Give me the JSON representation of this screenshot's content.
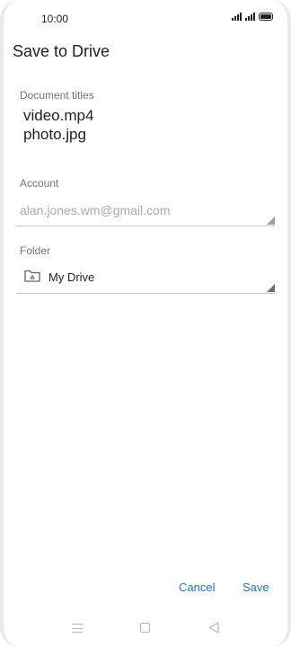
{
  "status_bar": {
    "time": "10:00"
  },
  "header": {
    "title": "Save to Drive"
  },
  "document": {
    "label": "Document titles",
    "titles": [
      "video.mp4",
      "photo.jpg"
    ]
  },
  "account": {
    "label": "Account",
    "value": "alan.jones.wm@gmail.com"
  },
  "folder": {
    "label": "Folder",
    "value": "My Drive",
    "icon": "drive-folder-icon"
  },
  "actions": {
    "cancel_label": "Cancel",
    "save_label": "Save"
  },
  "colors": {
    "accent": "#1a73e8",
    "text_primary": "#202124",
    "text_secondary": "#6f7378",
    "text_disabled": "#a8abad"
  }
}
